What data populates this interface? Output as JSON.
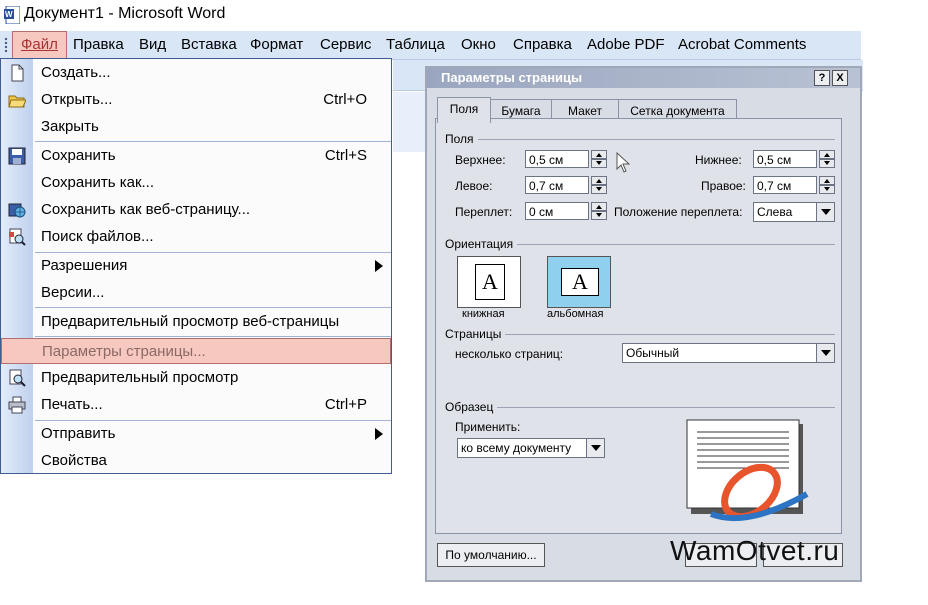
{
  "window": {
    "title": "Документ1 - Microsoft Word"
  },
  "menubar": {
    "items": [
      "Файл",
      "Правка",
      "Вид",
      "Вставка",
      "Формат",
      "Сервис",
      "Таблица",
      "Окно",
      "Справка",
      "Adobe PDF",
      "Acrobat Comments"
    ]
  },
  "file_menu": {
    "items": [
      {
        "label": "Создать...",
        "shortcut": "",
        "icon": "new-document-icon"
      },
      {
        "label": "Открыть...",
        "shortcut": "Ctrl+O",
        "icon": "open-folder-icon"
      },
      {
        "label": "Закрыть",
        "shortcut": "",
        "icon": ""
      },
      {
        "label": "Сохранить",
        "shortcut": "Ctrl+S",
        "icon": "save-icon"
      },
      {
        "label": "Сохранить как...",
        "shortcut": "",
        "icon": ""
      },
      {
        "label": "Сохранить как веб-страницу...",
        "shortcut": "",
        "icon": "save-web-icon"
      },
      {
        "label": "Поиск файлов...",
        "shortcut": "",
        "icon": "file-search-icon"
      },
      {
        "label": "Разрешения",
        "shortcut": "",
        "icon": ""
      },
      {
        "label": "Версии...",
        "shortcut": "",
        "icon": ""
      },
      {
        "label": "Предварительный просмотр веб-страницы",
        "shortcut": "",
        "icon": ""
      },
      {
        "label": "Параметры страницы...",
        "shortcut": "",
        "icon": ""
      },
      {
        "label": "Предварительный просмотр",
        "shortcut": "",
        "icon": "print-preview-icon"
      },
      {
        "label": "Печать...",
        "shortcut": "Ctrl+P",
        "icon": "print-icon"
      },
      {
        "label": "Отправить",
        "shortcut": "",
        "icon": ""
      },
      {
        "label": "Свойства",
        "shortcut": "",
        "icon": ""
      }
    ]
  },
  "dialog": {
    "title": "Параметры страницы",
    "help": "?",
    "close": "X",
    "tabs": [
      "Поля",
      "Бумага",
      "Макет",
      "Сетка документа"
    ],
    "margins": {
      "section": "Поля",
      "top_label": "Верхнее:",
      "top_value": "0,5 см",
      "bottom_label": "Нижнее:",
      "bottom_value": "0,5 см",
      "left_label": "Левое:",
      "left_value": "0,7 см",
      "right_label": "Правое:",
      "right_value": "0,7 см",
      "gutter_label": "Переплет:",
      "gutter_value": "0 см",
      "gutter_pos_label": "Положение переплета:",
      "gutter_pos_value": "Слева"
    },
    "orientation": {
      "section": "Ориентация",
      "portrait": "книжная",
      "landscape": "альбомная",
      "glyph": "A"
    },
    "pages": {
      "section": "Страницы",
      "multiple_label": "несколько страниц:",
      "multiple_value": "Обычный"
    },
    "sample": {
      "section": "Образец",
      "apply_label": "Применить:",
      "apply_value": "ко всему документу"
    },
    "default_button": "По умолчанию..."
  },
  "watermark": "WamOtvet.ru"
}
